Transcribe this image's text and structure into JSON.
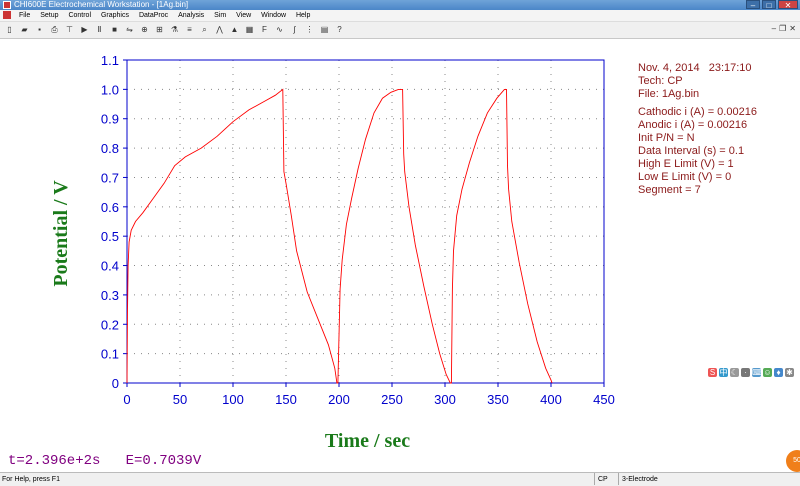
{
  "window": {
    "title": "CHI600E Electrochemical Workstation - [1Ag.bin]",
    "minimize": "–",
    "maximize": "□",
    "close": "✕"
  },
  "menu": [
    "File",
    "Setup",
    "Control",
    "Graphics",
    "DataProc",
    "Analysis",
    "Sim",
    "View",
    "Window",
    "Help"
  ],
  "toolbar_icons": [
    "new-icon",
    "open-icon",
    "save-icon",
    "print-icon",
    "tt-icon",
    "run-icon",
    "pause-icon",
    "stop-icon",
    "reverse-icon",
    "zoom-icon",
    "ir-comp-icon",
    "cell-icon",
    "overlay-icon",
    "zoom-in-icon",
    "peak-icon",
    "marker-icon",
    "color-icon",
    "font-icon",
    "smooth-icon",
    "derivative-icon",
    "integrate-icon",
    "table-icon",
    "help-icon"
  ],
  "info": {
    "date": "Nov. 4, 2014   23:17:10",
    "tech": "Tech: CP",
    "file": "File: 1Ag.bin",
    "params": [
      "Cathodic i (A) = 0.00216",
      "Anodic i (A) = 0.00216",
      "Init P/N = N",
      "Data Interval (s) = 0.1",
      "High E Limit (V) = 1",
      "Low E Limit (V) = 0",
      "Segment = 7"
    ]
  },
  "cursor_readout": "t=2.396e+2s   E=0.7039V",
  "status": {
    "help": "For Help, press F1",
    "tech": "CP",
    "electrode": "3-Electrode"
  },
  "float_button": "50",
  "colors": {
    "curve": "#ff0000",
    "axis": "#0000cc",
    "label": "#1a7a1a",
    "info": "#8b1a1a",
    "readout": "#800080"
  },
  "chart_data": {
    "type": "line",
    "xlabel": "Time / sec",
    "ylabel": "Potential / V",
    "xlim": [
      0,
      450
    ],
    "ylim": [
      0,
      1.1
    ],
    "xticks": [
      0,
      50,
      100,
      150,
      200,
      250,
      300,
      350,
      400,
      450
    ],
    "yticks": [
      0,
      0.1,
      0.2,
      0.3,
      0.4,
      0.5,
      0.6,
      0.7,
      0.8,
      0.9,
      1.0,
      1.1
    ],
    "ytick_labels": [
      "0",
      "0.1",
      "0.2",
      "0.3",
      "0.4",
      "0.5",
      "0.6",
      "0.7",
      "0.8",
      "0.9",
      "1.0",
      "1.1"
    ],
    "grid": true,
    "series": [
      {
        "x": [
          0,
          0.5,
          1,
          2,
          4,
          8,
          15,
          25,
          35,
          45,
          55,
          70,
          85,
          100,
          115,
          130,
          140,
          147,
          148,
          150,
          155,
          160,
          170,
          180,
          190,
          196,
          198,
          199,
          201,
          203,
          207,
          212,
          218,
          225,
          233,
          241,
          249,
          256,
          260,
          261,
          262,
          266,
          272,
          280,
          288,
          295,
          301,
          305,
          306,
          307,
          308,
          311,
          316,
          323,
          331,
          340,
          349,
          356,
          358,
          359,
          360,
          363,
          370,
          378,
          387,
          395,
          400,
          401
        ],
        "y": [
          0.0,
          0.25,
          0.4,
          0.48,
          0.52,
          0.55,
          0.58,
          0.63,
          0.68,
          0.74,
          0.77,
          0.8,
          0.84,
          0.89,
          0.93,
          0.96,
          0.98,
          1.0,
          0.72,
          0.68,
          0.57,
          0.45,
          0.31,
          0.22,
          0.13,
          0.05,
          0.0,
          0.0,
          0.32,
          0.42,
          0.54,
          0.63,
          0.73,
          0.83,
          0.92,
          0.97,
          0.99,
          1.0,
          1.0,
          0.78,
          0.72,
          0.6,
          0.47,
          0.33,
          0.2,
          0.1,
          0.03,
          0.0,
          0.0,
          0.32,
          0.45,
          0.57,
          0.66,
          0.75,
          0.84,
          0.92,
          0.97,
          1.0,
          1.0,
          0.74,
          0.66,
          0.55,
          0.41,
          0.27,
          0.14,
          0.05,
          0.01,
          0.0
        ]
      }
    ]
  }
}
